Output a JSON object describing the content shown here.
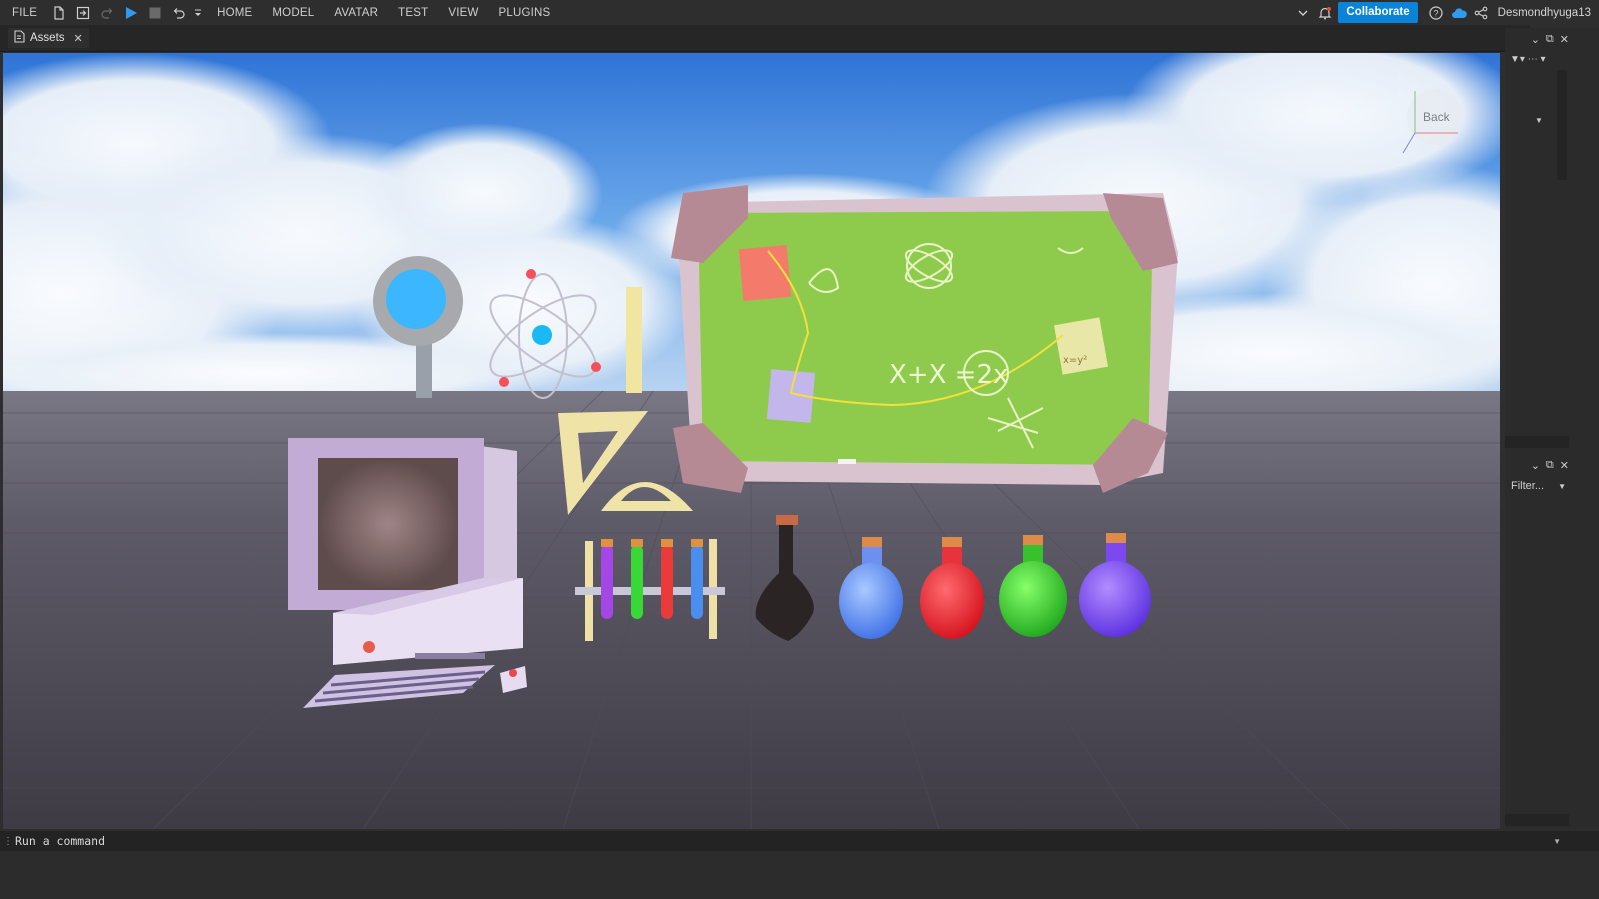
{
  "menu": {
    "file": "FILE",
    "home": "HOME",
    "model": "MODEL",
    "avatar": "AVATAR",
    "test": "TEST",
    "view": "VIEW",
    "plugins": "PLUGINS"
  },
  "toolbar": {
    "collaborate_label": "Collaborate",
    "username": "Desmondhyuga13"
  },
  "tabs": [
    {
      "label": "Assets",
      "active": true
    }
  ],
  "viewport": {
    "view_cube_label": "Back",
    "chalkboard_text": "X+X =2x",
    "sticky_note_text": "x=y²"
  },
  "right_panel": {
    "filter_placeholder": "Filter..."
  },
  "command_bar": {
    "placeholder": "Run a command"
  },
  "colors": {
    "accent": "#0a84d8",
    "play": "#2f9bf0",
    "chalkboard": "#8ecb4c"
  }
}
